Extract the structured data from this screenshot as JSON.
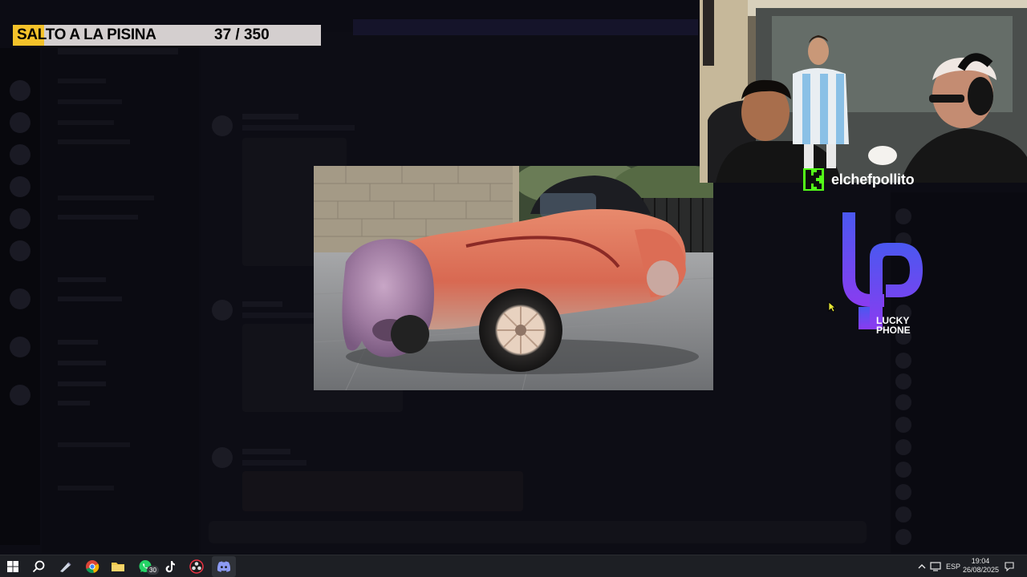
{
  "overlay": {
    "title": "SALTO A LA PISINA",
    "counter": "37 / 350"
  },
  "stream": {
    "streamer_name": "elchefpollito",
    "platform_icon": "kick-logo-icon",
    "sponsor": {
      "name_line1": "LUCKY",
      "name_line2": "PHONE",
      "logo_icon": "lucky-phone-logo-icon"
    }
  },
  "taskbar": {
    "icons": [
      "windows-start-icon",
      "search-icon",
      "pen-app-icon",
      "chrome-icon",
      "file-explorer-icon",
      "whatsapp-icon",
      "tiktok-icon",
      "obs-icon",
      "discord-icon"
    ],
    "whatsapp_badge": "30",
    "language": "ESP",
    "time": "19:04",
    "date": "26/08/2025"
  },
  "colors": {
    "accent_yellow": "#f4c22a",
    "kick_green": "#53fc18",
    "lucky_phone_purple": "#6b3ff2",
    "taskbar_bg": "#1d1f24"
  }
}
